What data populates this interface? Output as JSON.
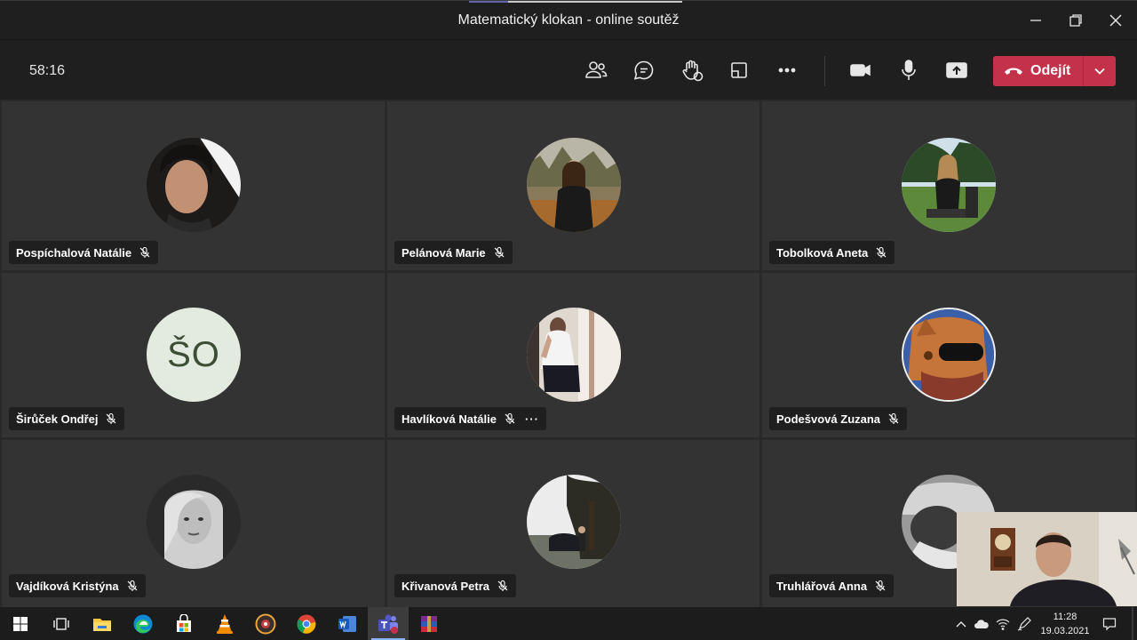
{
  "window": {
    "title": "Matematický klokan - online soutěž"
  },
  "toolbar": {
    "timer": "58:16",
    "leave_label": "Odejít",
    "icons": [
      "participants-icon",
      "chat-icon",
      "raise-hand-icon",
      "room-icon",
      "more-icon",
      "camera-icon",
      "microphone-icon",
      "share-icon"
    ]
  },
  "participants": [
    {
      "name": "Pospíchalová Natálie",
      "muted": true
    },
    {
      "name": "Pelánová Marie",
      "muted": true
    },
    {
      "name": "Tobolková Aneta",
      "muted": true
    },
    {
      "name": "Širůček Ondřej",
      "muted": true,
      "initials": "ŠO"
    },
    {
      "name": "Havlíková Natálie",
      "muted": true,
      "more": "···"
    },
    {
      "name": "Podešvová Zuzana",
      "muted": true
    },
    {
      "name": "Vajdíková Kristýna",
      "muted": true
    },
    {
      "name": "Křivanová Petra",
      "muted": true
    },
    {
      "name": "Truhlářová Anna",
      "muted": true
    }
  ],
  "taskbar": {
    "apps": [
      "start-icon",
      "task-view-icon",
      "file-explorer-icon",
      "edge-icon",
      "store-icon",
      "vlc-icon",
      "media-player-icon",
      "chrome-icon",
      "word-icon",
      "teams-icon",
      "winrar-icon"
    ],
    "active_app": "teams-icon",
    "time": "11:28",
    "date": "19.03.2021"
  }
}
